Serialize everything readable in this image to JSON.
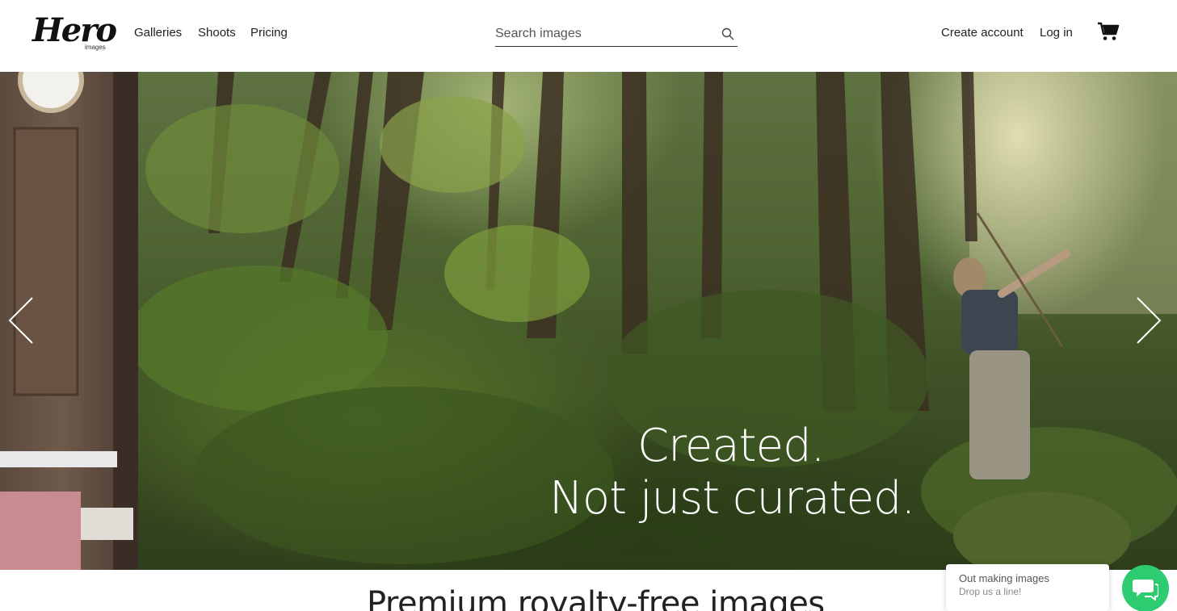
{
  "header": {
    "logo": {
      "word": "Hero",
      "sub": "images"
    },
    "nav": {
      "galleries": "Galleries",
      "shoots": "Shoots",
      "pricing": "Pricing"
    },
    "search": {
      "placeholder": "Search images",
      "icon": "search-icon"
    },
    "account": {
      "create": "Create account",
      "login": "Log in"
    },
    "cart_icon": "cart-icon"
  },
  "hero": {
    "tagline_line1": "Created.",
    "tagline_line2": "Not just curated.",
    "prev_icon": "chevron-left-icon",
    "next_icon": "chevron-right-icon"
  },
  "main": {
    "section_title": "Premium royalty-free images"
  },
  "chat": {
    "line1": "Out making images",
    "line2": "Drop us a line!",
    "color": "#2ecc71",
    "icon": "chat-icon"
  }
}
